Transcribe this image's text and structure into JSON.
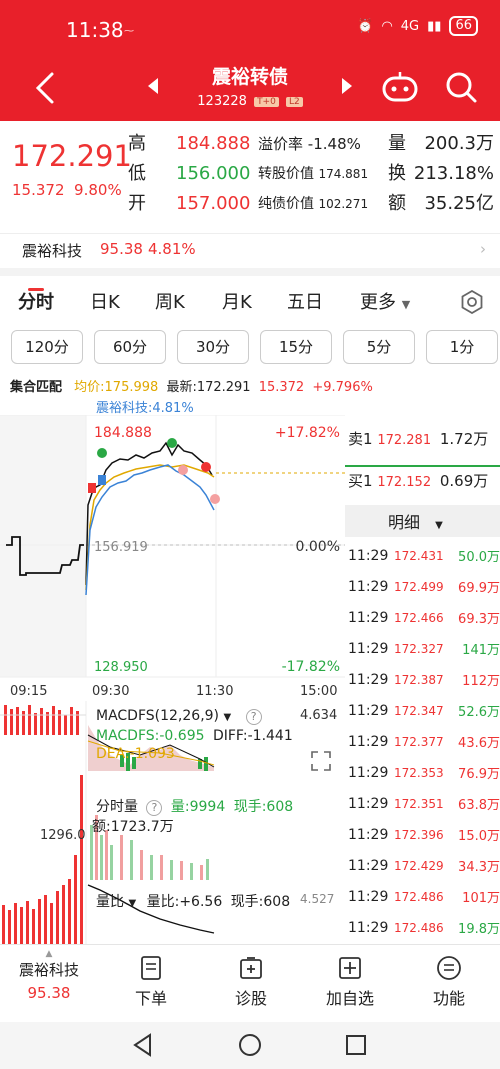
{
  "status": {
    "time": "11:38",
    "network": "4G",
    "battery": "66"
  },
  "header": {
    "title": "震裕转债",
    "code": "123228",
    "tag1": "T+0",
    "tag2": "L2"
  },
  "quote": {
    "price": "172.291",
    "change": "15.372",
    "change_pct": "9.80%",
    "high_label": "高",
    "high": "184.888",
    "low_label": "低",
    "low": "156.000",
    "open_label": "开",
    "open": "157.000",
    "premium_label": "溢价率",
    "premium": "-1.48%",
    "conv_label": "转股价值",
    "conv": "174.881",
    "bond_label": "纯债价值",
    "bond": "102.271",
    "vol_label": "量",
    "vol": "200.3万",
    "turnover_label": "换",
    "turnover": "213.18%",
    "amount_label": "额",
    "amount": "35.25亿"
  },
  "related": {
    "name": "震裕科技",
    "price": "95.38",
    "pct": "4.81%"
  },
  "tabs": [
    "分时",
    "日K",
    "周K",
    "月K",
    "五日",
    "更多"
  ],
  "periods": [
    "120分",
    "60分",
    "30分",
    "15分",
    "5分",
    "1分"
  ],
  "legend": {
    "mode": "集合匹配",
    "avg": "均价:175.998",
    "latest": "最新:172.291",
    "chg": "15.372",
    "pct": "+9.796%",
    "stock": "震裕科技:4.81%"
  },
  "chart": {
    "high": "184.888",
    "mid": "156.919",
    "low": "128.950",
    "up_pct": "+17.82%",
    "zero_pct": "0.00%",
    "down_pct": "-17.82%",
    "times": [
      "09:15",
      "09:30",
      "11:30",
      "15:00"
    ],
    "macd_title": "MACDFS(12,26,9)",
    "macd_val": "4.634",
    "macd_line": "MACDFS:-0.695",
    "diff": "DIFF:-1.441",
    "dea": "DEA:-1.093",
    "vol_title": "分时量",
    "vol_q": "量:9994",
    "vol_now": "现手:608",
    "vol_amt": "额:1723.7万",
    "vol_axis": "1296.0",
    "ratio_title": "量比",
    "ratio_val": "量比:+6.56",
    "ratio_now": "现手:608",
    "ratio_axis": "4.527"
  },
  "orderbook": {
    "ask_label": "卖1",
    "ask_price": "172.281",
    "ask_vol": "1.72万",
    "bid_label": "买1",
    "bid_price": "172.152",
    "bid_vol": "0.69万",
    "detail": "明细"
  },
  "trades": [
    {
      "t": "11:29",
      "p": "172.431",
      "v": "50.0万",
      "c": "green"
    },
    {
      "t": "11:29",
      "p": "172.499",
      "v": "69.9万",
      "c": "red"
    },
    {
      "t": "11:29",
      "p": "172.466",
      "v": "69.3万",
      "c": "red"
    },
    {
      "t": "11:29",
      "p": "172.327",
      "v": "141万",
      "c": "green"
    },
    {
      "t": "11:29",
      "p": "172.387",
      "v": "112万",
      "c": "red"
    },
    {
      "t": "11:29",
      "p": "172.347",
      "v": "52.6万",
      "c": "green"
    },
    {
      "t": "11:29",
      "p": "172.377",
      "v": "43.6万",
      "c": "red"
    },
    {
      "t": "11:29",
      "p": "172.353",
      "v": "76.9万",
      "c": "red"
    },
    {
      "t": "11:29",
      "p": "172.351",
      "v": "63.8万",
      "c": "red"
    },
    {
      "t": "11:29",
      "p": "172.396",
      "v": "15.0万",
      "c": "red"
    },
    {
      "t": "11:29",
      "p": "172.429",
      "v": "34.3万",
      "c": "red"
    },
    {
      "t": "11:29",
      "p": "172.486",
      "v": "101万",
      "c": "red"
    },
    {
      "t": "11:29",
      "p": "172.486",
      "v": "19.8万",
      "c": "green"
    }
  ],
  "bottom": {
    "stock_name": "震裕科技",
    "stock_price": "95.38",
    "order": "下单",
    "diagnose": "诊股",
    "add": "加自选",
    "func": "功能"
  },
  "colors": {
    "brand": "#e8202a",
    "up": "#e33333",
    "down": "#2aa845",
    "avg": "#e0a800",
    "stock": "#3b83d6"
  }
}
